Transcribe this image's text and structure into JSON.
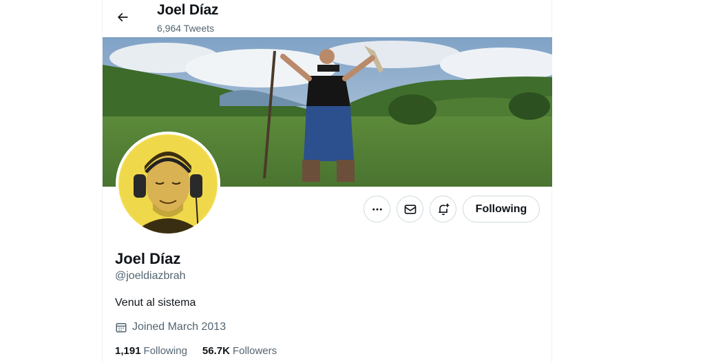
{
  "header": {
    "name": "Joel Díaz",
    "tweet_count": "6,964 Tweets",
    "back_icon": "arrow-left-icon"
  },
  "profile": {
    "name": "Joel Díaz",
    "handle": "@joeldiazbrah",
    "bio": "Venut al sistema",
    "joined": "Joined March 2013",
    "joined_icon": "calendar-icon"
  },
  "actions": {
    "more_icon": "more-icon",
    "message_icon": "envelope-icon",
    "notify_icon": "bell-plus-icon",
    "following_label": "Following"
  },
  "stats": {
    "following_count": "1,191",
    "following_label": "Following",
    "followers_count": "56.7K",
    "followers_label": "Followers"
  },
  "colors": {
    "text": "#0f1419",
    "secondary": "#536471",
    "border": "#cfd9de"
  }
}
